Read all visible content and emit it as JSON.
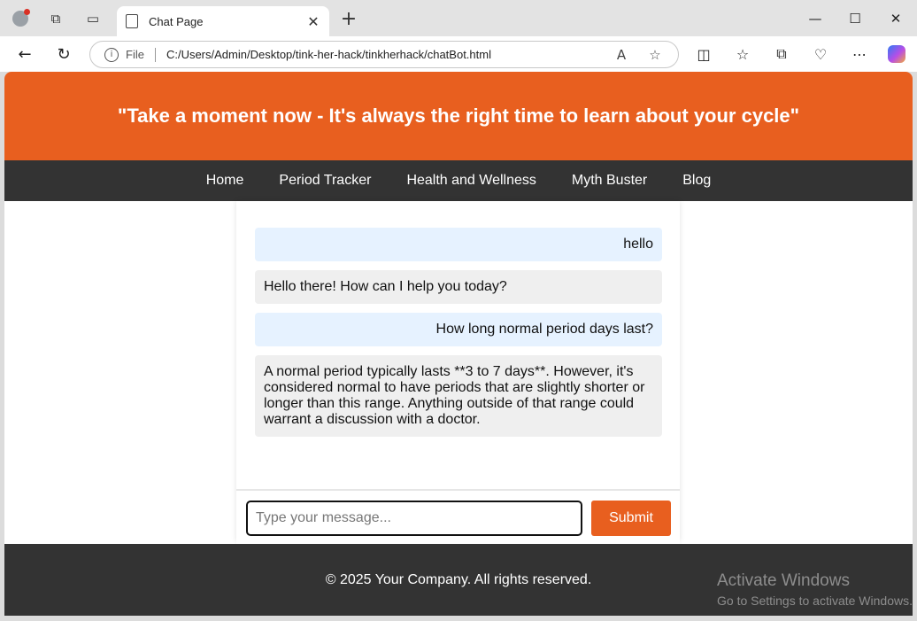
{
  "browser": {
    "tab_title": "Chat Page",
    "url_scheme": "File",
    "url": "C:/Users/Admin/Desktop/tink-her-hack/tinkherhack/chatBot.html"
  },
  "hero": {
    "quote": "\"Take a moment now - It's always the right time to learn about your cycle\""
  },
  "nav": {
    "items": [
      {
        "label": "Home"
      },
      {
        "label": "Period Tracker"
      },
      {
        "label": "Health and Wellness"
      },
      {
        "label": "Myth Buster"
      },
      {
        "label": "Blog"
      }
    ]
  },
  "chat": {
    "messages": [
      {
        "role": "user",
        "text": "hello"
      },
      {
        "role": "bot",
        "text": "Hello there! How can I help you today?"
      },
      {
        "role": "user",
        "text": "How long normal period days last?"
      },
      {
        "role": "bot",
        "text": "A normal period typically lasts **3 to 7 days**. However, it's considered normal to have periods that are slightly shorter or longer than this range. Anything outside of that range could warrant a discussion with a doctor."
      }
    ],
    "input_placeholder": "Type your message...",
    "submit_label": "Submit"
  },
  "footer": {
    "text": "© 2025 Your Company. All rights reserved."
  },
  "watermark": {
    "title": "Activate Windows",
    "subtitle": "Go to Settings to activate Windows."
  },
  "colors": {
    "accent": "#e85f1f",
    "nav_bg": "#333333",
    "user_bubble": "#e6f2ff",
    "bot_bubble": "#efefef"
  }
}
